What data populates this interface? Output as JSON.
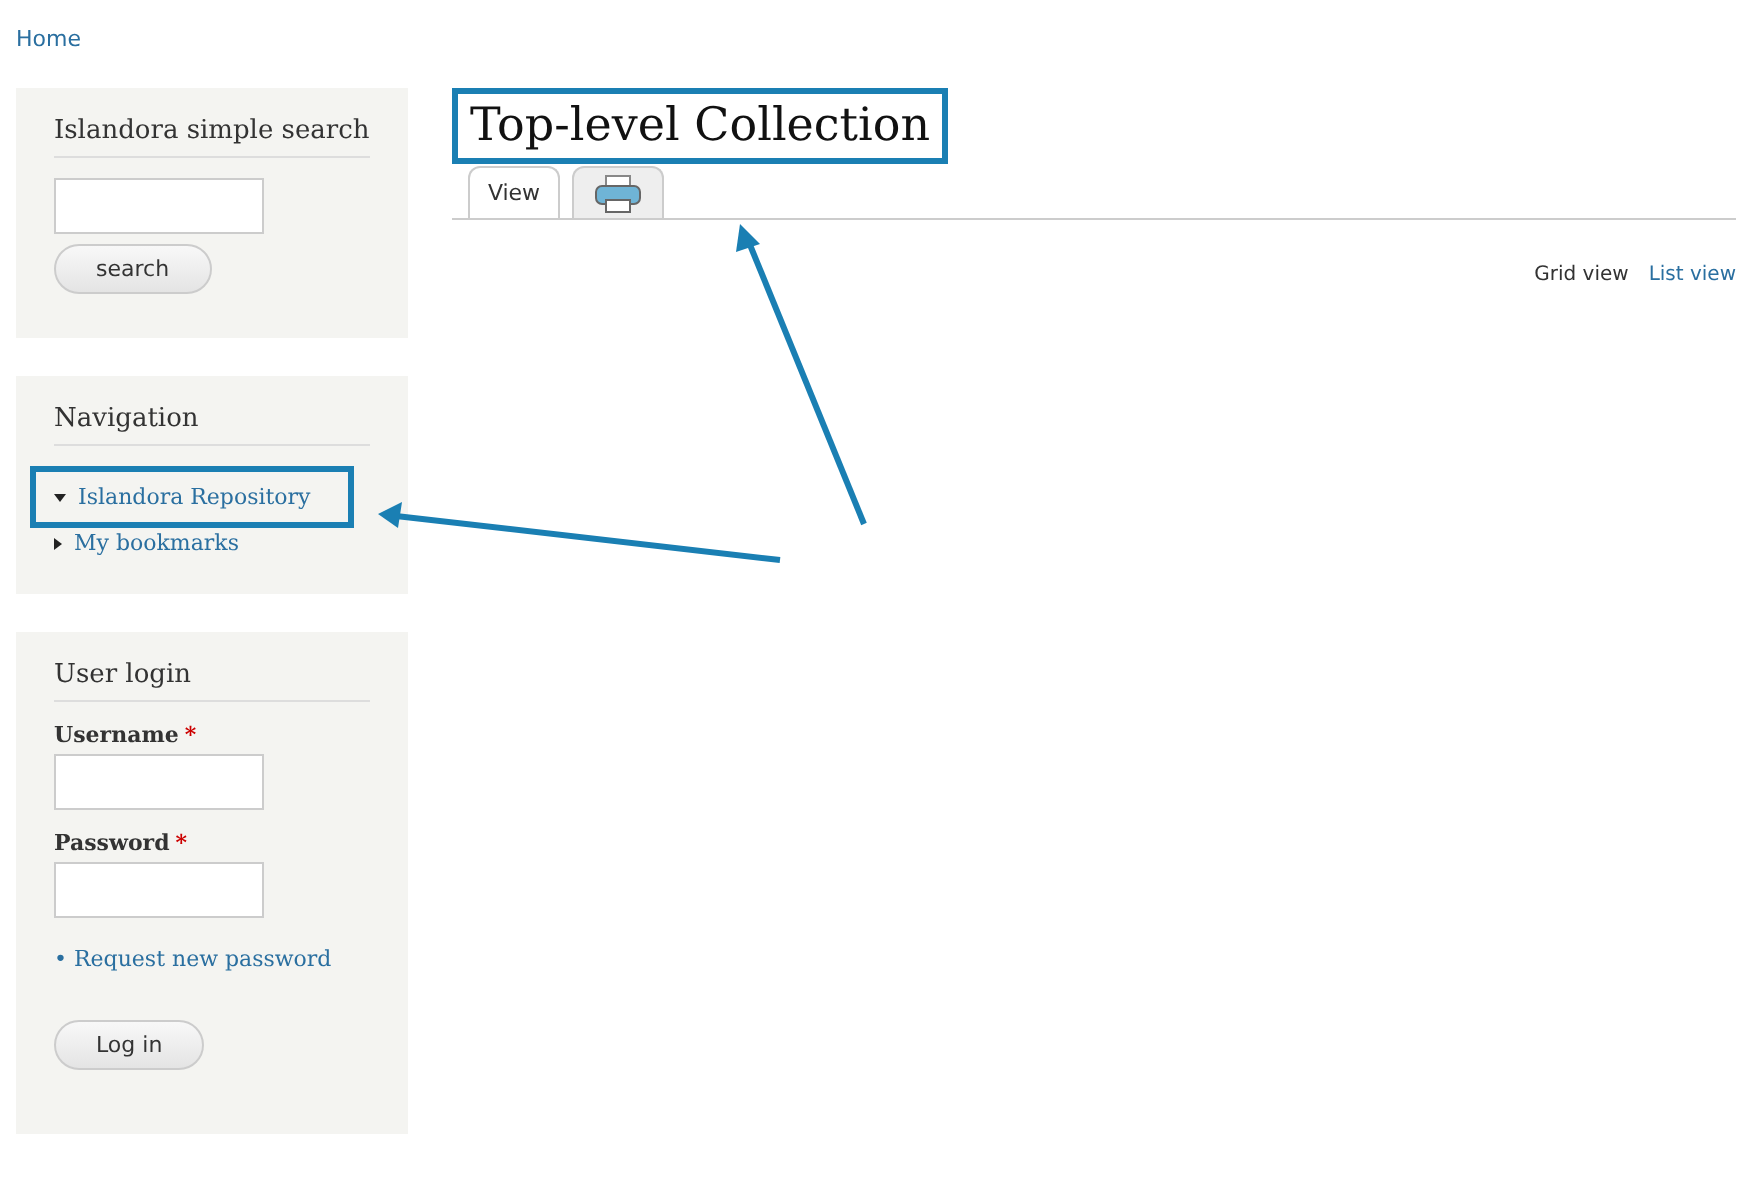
{
  "breadcrumb": "Home",
  "search_block": {
    "title": "Islandora simple search",
    "button": "search"
  },
  "navigation": {
    "title": "Navigation",
    "items": [
      {
        "label": "Islandora Repository",
        "expanded": true,
        "highlighted": true
      },
      {
        "label": "My bookmarks",
        "expanded": false,
        "highlighted": false
      }
    ]
  },
  "login": {
    "title": "User login",
    "fields": [
      {
        "label": "Username",
        "required_mark": "*"
      },
      {
        "label": "Password",
        "required_mark": "*"
      }
    ],
    "link_bullet": "•",
    "link": "Request new password",
    "button": "Log in"
  },
  "page_title": "Top-level Collection",
  "tabs": [
    {
      "kind": "text",
      "label": "View",
      "selected": true
    },
    {
      "kind": "print",
      "selected": false
    }
  ],
  "view_modes": [
    {
      "label": "Grid view",
      "selected": true
    },
    {
      "label": "List view",
      "selected": false
    }
  ]
}
